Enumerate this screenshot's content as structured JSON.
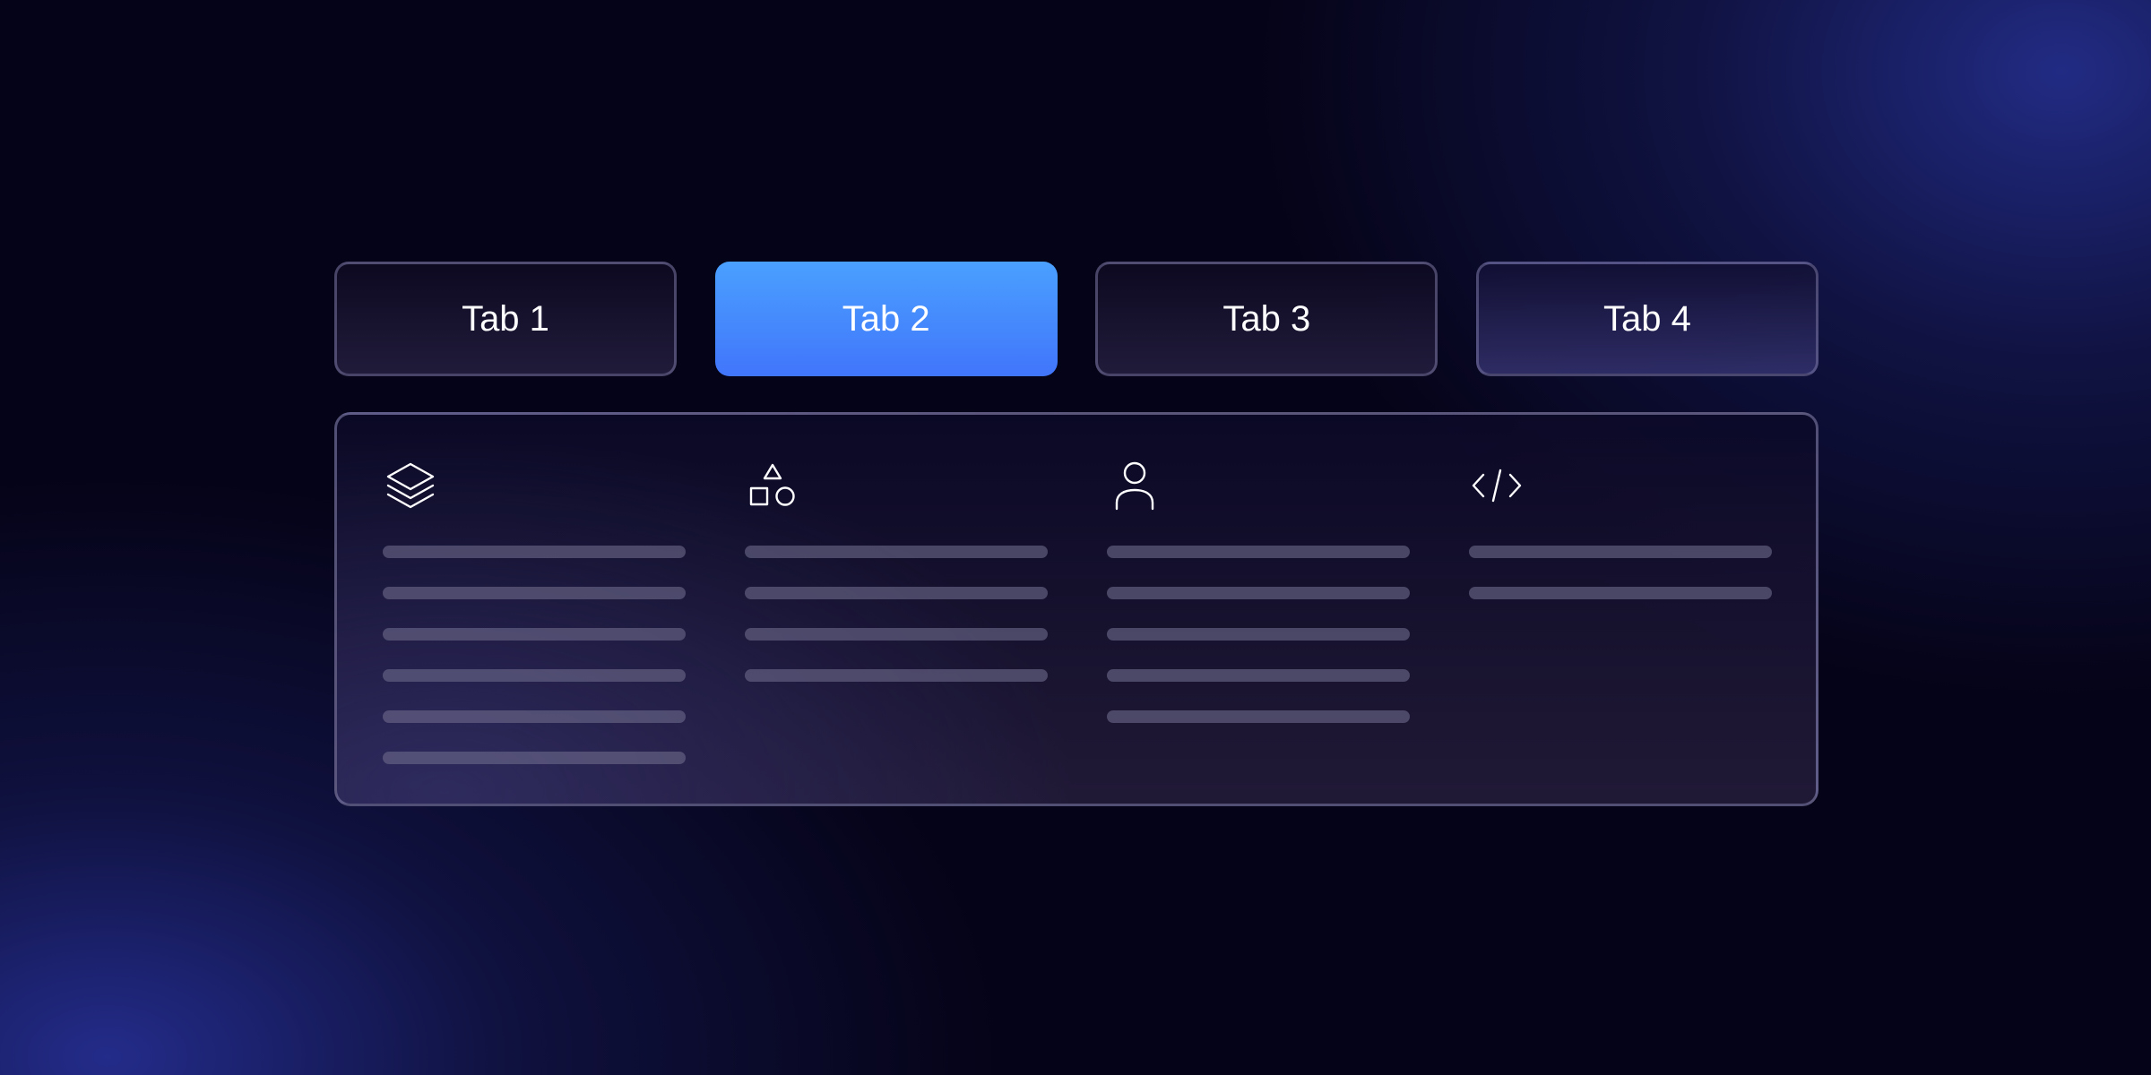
{
  "tabs": [
    {
      "label": "Tab 1",
      "active": false
    },
    {
      "label": "Tab 2",
      "active": true
    },
    {
      "label": "Tab 3",
      "active": false
    },
    {
      "label": "Tab 4",
      "active": false
    }
  ],
  "panel": {
    "columns": [
      {
        "icon": "layers-icon",
        "placeholder_lines": 6
      },
      {
        "icon": "shapes-icon",
        "placeholder_lines": 4
      },
      {
        "icon": "user-icon",
        "placeholder_lines": 5
      },
      {
        "icon": "code-icon",
        "placeholder_lines": 2
      }
    ]
  },
  "colors": {
    "accent_top": "#4aa0ff",
    "accent_bottom": "#4175fb",
    "background": "#050317",
    "text": "#ffffff"
  }
}
